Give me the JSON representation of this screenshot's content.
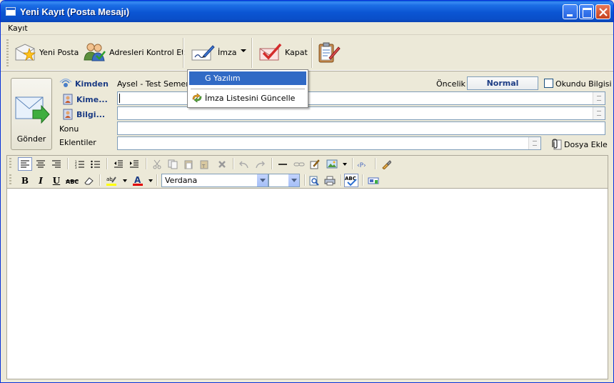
{
  "window": {
    "title": "Yeni Kayıt (Posta Mesajı)"
  },
  "menu": {
    "items": [
      "Kayıt"
    ]
  },
  "toolbar": {
    "new_mail": "Yeni Posta",
    "check_addresses": "Adresleri Kontrol Et",
    "signature": "İmza",
    "close": "Kapat"
  },
  "signature_menu": {
    "items": [
      "G Yazılım",
      "İmza Listesini Güncelle"
    ]
  },
  "header": {
    "send": "Gönder",
    "from_label": "Kimden",
    "from_value": "Aysel - Test Semere",
    "to_label": "Kime...",
    "cc_label": "Bilgi...",
    "subject_label": "Konu",
    "attachments_label": "Eklentiler",
    "priority_label": "Öncelik",
    "priority_value": "Normal",
    "read_receipt_label": "Okundu Bilgisi",
    "add_file": "Dosya Ekle"
  },
  "editor": {
    "font_name": "Verdana",
    "font_size": ""
  },
  "colors": {
    "titlebar": "#0b55d3",
    "selection": "#316ac5",
    "label_blue": "#1c3c84"
  }
}
